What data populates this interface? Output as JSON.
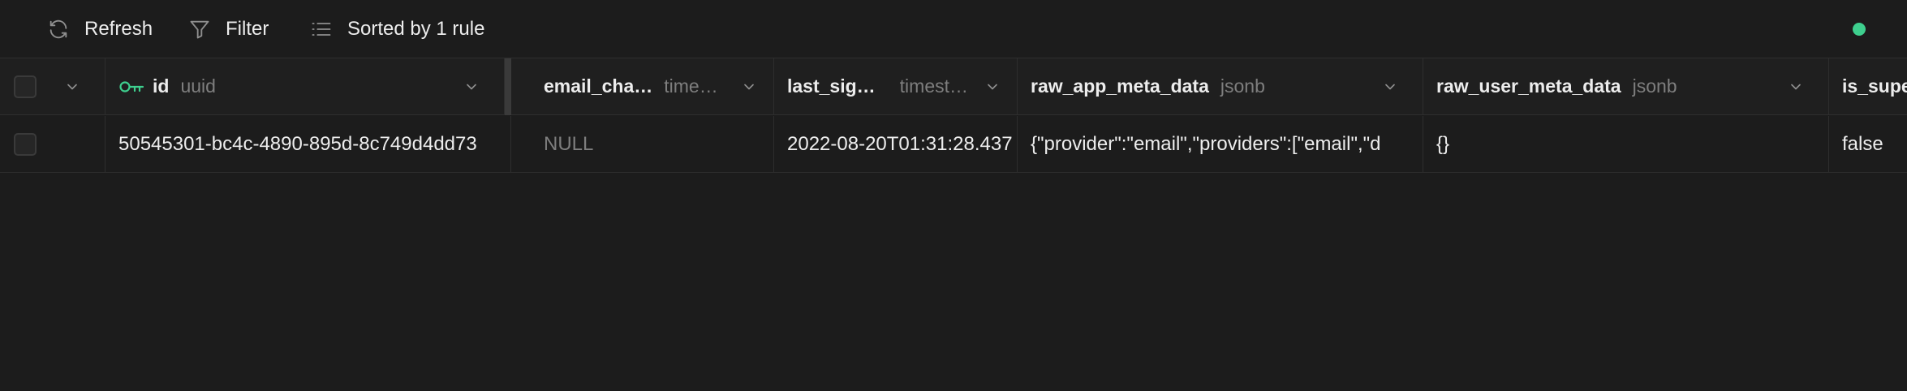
{
  "toolbar": {
    "refresh_label": "Refresh",
    "filter_label": "Filter",
    "sort_label": "Sorted by 1 rule",
    "icons": [
      "refresh-icon",
      "filter-icon",
      "list-icon"
    ],
    "status_color": "#3ecf8e"
  },
  "columns": [
    {
      "name": "id",
      "type": "uuid",
      "key_icon": true
    },
    {
      "name": "email_cha…",
      "type": "time…"
    },
    {
      "name": "last_sig…",
      "type": "timest…"
    },
    {
      "name": "raw_app_meta_data",
      "type": "jsonb"
    },
    {
      "name": "raw_user_meta_data",
      "type": "jsonb"
    },
    {
      "name": "is_supe",
      "type": ""
    }
  ],
  "rows": [
    {
      "cells": [
        "50545301-bc4c-4890-895d-8c749d4dd73",
        "NULL",
        "2022-08-20T01:31:28.437",
        "{\"provider\":\"email\",\"providers\":[\"email\",\"d",
        "{}",
        "false"
      ]
    }
  ],
  "colors": {
    "background": "#1c1c1c",
    "border": "#2e2e2e",
    "accent": "#3ecf8e",
    "muted_text": "#7e7e7e"
  }
}
